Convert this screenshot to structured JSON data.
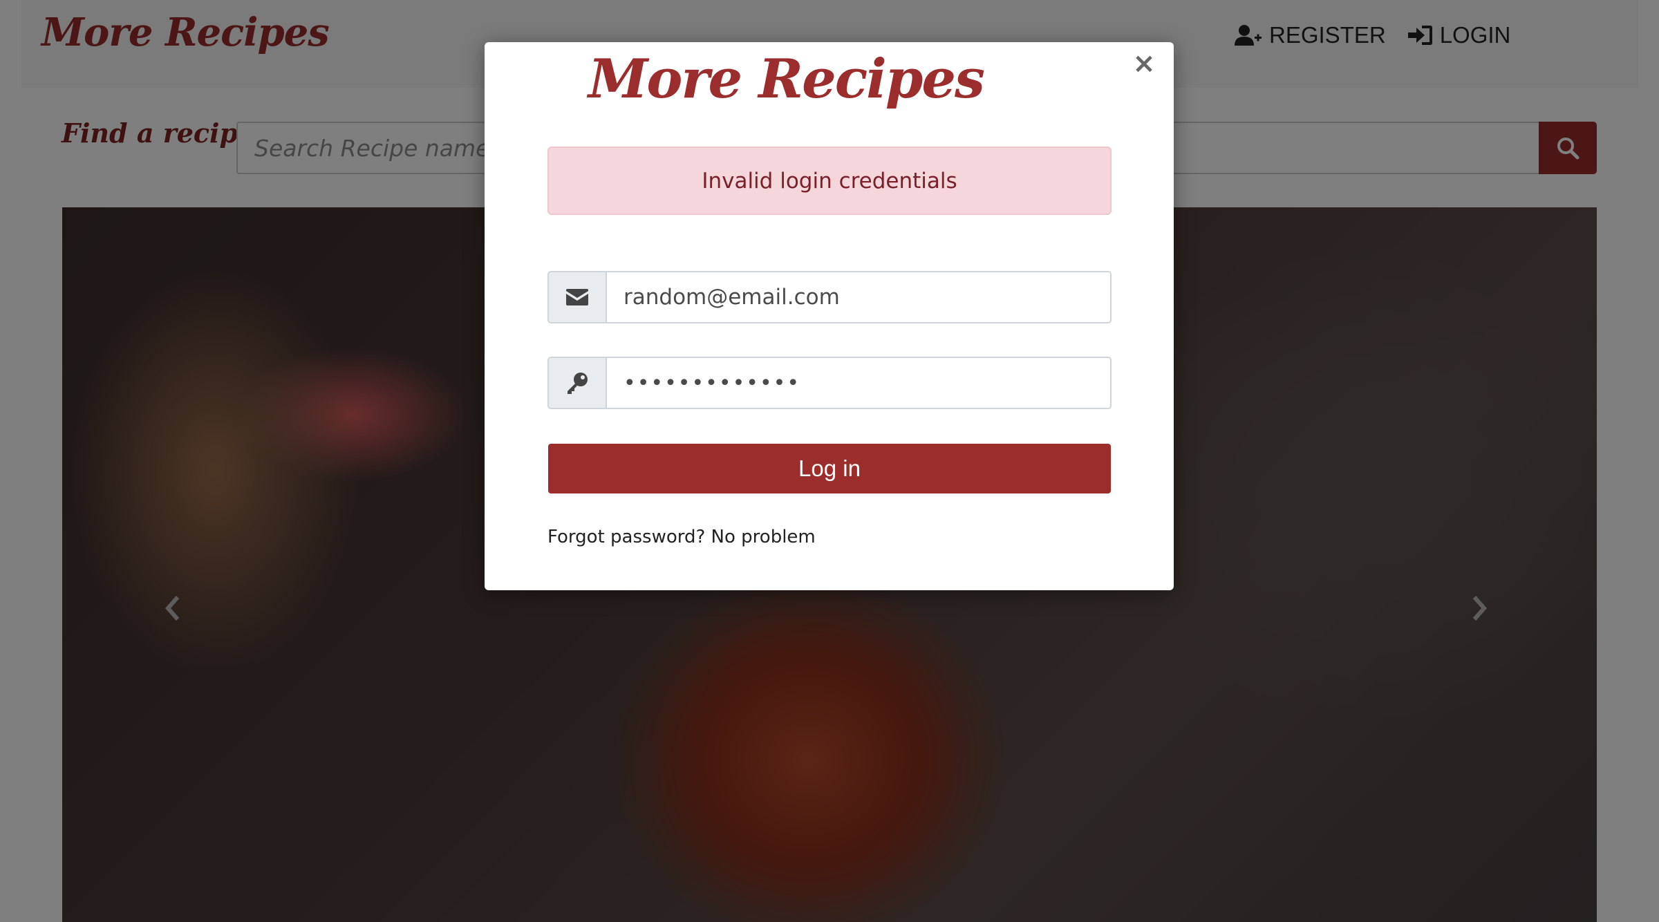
{
  "navbar": {
    "brand": "More Recipes",
    "register_label": "REGISTER",
    "login_label": "LOGIN"
  },
  "search": {
    "label": "Find a recipe:",
    "placeholder": "Search Recipe name or"
  },
  "modal": {
    "logo": "More Recipes",
    "close_symbol": "×",
    "alert": "Invalid login credentials",
    "email_value": "random@email.com",
    "password_value": "•••••••••••••",
    "login_button": "Log in",
    "forgot_prefix": "Forgot password?",
    "forgot_link": "No problem"
  },
  "colors": {
    "brand": "#9b2d2d",
    "alert_bg": "#f4d6db",
    "alert_text": "#7a2028"
  },
  "icons": {
    "register": "user-plus-icon",
    "login": "sign-in-icon",
    "search": "search-icon",
    "email": "envelope-icon",
    "password": "key-icon",
    "carousel_prev": "chevron-left-icon",
    "carousel_next": "chevron-right-icon"
  }
}
